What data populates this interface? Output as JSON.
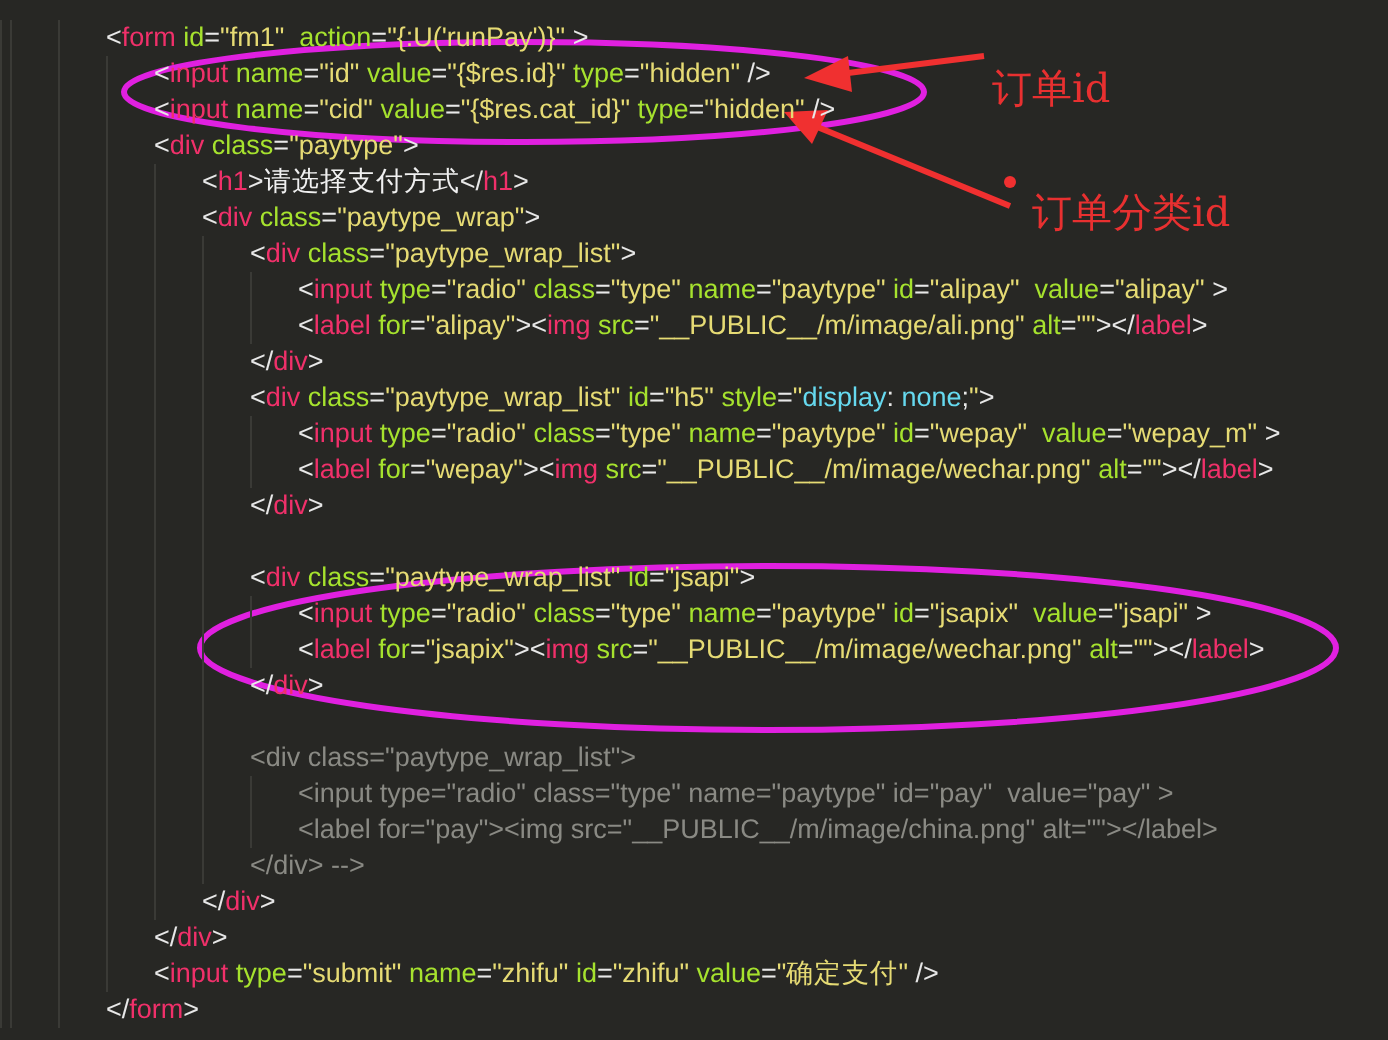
{
  "editor": {
    "lines": [
      {
        "tokens": [
          {
            "kind": "punct",
            "text": "<"
          },
          {
            "kind": "tag",
            "text": "form"
          },
          {
            "kind": "attr",
            "text": " id"
          },
          {
            "kind": "punct",
            "text": "="
          },
          {
            "kind": "string",
            "text": "\"fm1\""
          },
          {
            "kind": "attr",
            "text": "  action"
          },
          {
            "kind": "punct",
            "text": "="
          },
          {
            "kind": "string",
            "text": "\"{:U('runPay')}\""
          },
          {
            "kind": "punct",
            "text": " >"
          }
        ],
        "children": [
          {
            "tokens": [
              {
                "kind": "punct",
                "text": "<"
              },
              {
                "kind": "tag",
                "text": "input"
              },
              {
                "kind": "attr",
                "text": " name"
              },
              {
                "kind": "punct",
                "text": "="
              },
              {
                "kind": "string",
                "text": "\"id\""
              },
              {
                "kind": "attr",
                "text": " value"
              },
              {
                "kind": "punct",
                "text": "="
              },
              {
                "kind": "string",
                "text": "\"{$res.id}\""
              },
              {
                "kind": "attr",
                "text": " type"
              },
              {
                "kind": "punct",
                "text": "="
              },
              {
                "kind": "string",
                "text": "\"hidden\""
              },
              {
                "kind": "punct",
                "text": " />"
              }
            ]
          },
          {
            "tokens": [
              {
                "kind": "punct",
                "text": "<"
              },
              {
                "kind": "tag",
                "text": "input"
              },
              {
                "kind": "attr",
                "text": " name"
              },
              {
                "kind": "punct",
                "text": "="
              },
              {
                "kind": "string",
                "text": "\"cid\""
              },
              {
                "kind": "attr",
                "text": " value"
              },
              {
                "kind": "punct",
                "text": "="
              },
              {
                "kind": "string",
                "text": "\"{$res.cat_id}\""
              },
              {
                "kind": "attr",
                "text": " type"
              },
              {
                "kind": "punct",
                "text": "="
              },
              {
                "kind": "string",
                "text": "\"hidden\""
              },
              {
                "kind": "punct",
                "text": " />"
              }
            ]
          },
          {
            "tokens": [
              {
                "kind": "punct",
                "text": "<"
              },
              {
                "kind": "tag",
                "text": "div"
              },
              {
                "kind": "attr",
                "text": " class"
              },
              {
                "kind": "punct",
                "text": "="
              },
              {
                "kind": "string",
                "text": "\"paytype\""
              },
              {
                "kind": "punct",
                "text": ">"
              }
            ],
            "children": [
              {
                "tokens": [
                  {
                    "kind": "punct",
                    "text": "<"
                  },
                  {
                    "kind": "tag",
                    "text": "h1"
                  },
                  {
                    "kind": "punct",
                    "text": ">"
                  },
                  {
                    "kind": "text",
                    "text": "请选择支付方式"
                  },
                  {
                    "kind": "punct",
                    "text": "</"
                  },
                  {
                    "kind": "tag",
                    "text": "h1"
                  },
                  {
                    "kind": "punct",
                    "text": ">"
                  }
                ]
              },
              {
                "tokens": [
                  {
                    "kind": "punct",
                    "text": "<"
                  },
                  {
                    "kind": "tag",
                    "text": "div"
                  },
                  {
                    "kind": "attr",
                    "text": " class"
                  },
                  {
                    "kind": "punct",
                    "text": "="
                  },
                  {
                    "kind": "string",
                    "text": "\"paytype_wrap\""
                  },
                  {
                    "kind": "punct",
                    "text": ">"
                  }
                ],
                "children": [
                  {
                    "tokens": [
                      {
                        "kind": "punct",
                        "text": "<"
                      },
                      {
                        "kind": "tag",
                        "text": "div"
                      },
                      {
                        "kind": "attr",
                        "text": " class"
                      },
                      {
                        "kind": "punct",
                        "text": "="
                      },
                      {
                        "kind": "string",
                        "text": "\"paytype_wrap_list\""
                      },
                      {
                        "kind": "punct",
                        "text": ">"
                      }
                    ],
                    "children": [
                      {
                        "tokens": [
                          {
                            "kind": "punct",
                            "text": "<"
                          },
                          {
                            "kind": "tag",
                            "text": "input"
                          },
                          {
                            "kind": "attr",
                            "text": " type"
                          },
                          {
                            "kind": "punct",
                            "text": "="
                          },
                          {
                            "kind": "string",
                            "text": "\"radio\""
                          },
                          {
                            "kind": "attr",
                            "text": " class"
                          },
                          {
                            "kind": "punct",
                            "text": "="
                          },
                          {
                            "kind": "string",
                            "text": "\"type\""
                          },
                          {
                            "kind": "attr",
                            "text": " name"
                          },
                          {
                            "kind": "punct",
                            "text": "="
                          },
                          {
                            "kind": "string",
                            "text": "\"paytype\""
                          },
                          {
                            "kind": "attr",
                            "text": " id"
                          },
                          {
                            "kind": "punct",
                            "text": "="
                          },
                          {
                            "kind": "string",
                            "text": "\"alipay\""
                          },
                          {
                            "kind": "attr",
                            "text": "  value"
                          },
                          {
                            "kind": "punct",
                            "text": "="
                          },
                          {
                            "kind": "string",
                            "text": "\"alipay\""
                          },
                          {
                            "kind": "punct",
                            "text": " >"
                          }
                        ]
                      },
                      {
                        "tokens": [
                          {
                            "kind": "punct",
                            "text": "<"
                          },
                          {
                            "kind": "tag",
                            "text": "label"
                          },
                          {
                            "kind": "attr",
                            "text": " for"
                          },
                          {
                            "kind": "punct",
                            "text": "="
                          },
                          {
                            "kind": "string",
                            "text": "\"alipay\""
                          },
                          {
                            "kind": "punct",
                            "text": "><"
                          },
                          {
                            "kind": "tag",
                            "text": "img"
                          },
                          {
                            "kind": "attr",
                            "text": " src"
                          },
                          {
                            "kind": "punct",
                            "text": "="
                          },
                          {
                            "kind": "string",
                            "text": "\"__PUBLIC__/m/image/ali.png\""
                          },
                          {
                            "kind": "attr",
                            "text": " alt"
                          },
                          {
                            "kind": "punct",
                            "text": "="
                          },
                          {
                            "kind": "string",
                            "text": "\"\""
                          },
                          {
                            "kind": "punct",
                            "text": "></"
                          },
                          {
                            "kind": "tag",
                            "text": "label"
                          },
                          {
                            "kind": "punct",
                            "text": ">"
                          }
                        ]
                      }
                    ]
                  },
                  {
                    "tokens": [
                      {
                        "kind": "punct",
                        "text": "</"
                      },
                      {
                        "kind": "tag",
                        "text": "div"
                      },
                      {
                        "kind": "punct",
                        "text": ">"
                      }
                    ]
                  },
                  {
                    "tokens": [
                      {
                        "kind": "punct",
                        "text": "<"
                      },
                      {
                        "kind": "tag",
                        "text": "div"
                      },
                      {
                        "kind": "attr",
                        "text": " class"
                      },
                      {
                        "kind": "punct",
                        "text": "="
                      },
                      {
                        "kind": "string",
                        "text": "\"paytype_wrap_list\""
                      },
                      {
                        "kind": "attr",
                        "text": " id"
                      },
                      {
                        "kind": "punct",
                        "text": "="
                      },
                      {
                        "kind": "string",
                        "text": "\"h5\""
                      },
                      {
                        "kind": "attr",
                        "text": " style"
                      },
                      {
                        "kind": "punct",
                        "text": "="
                      },
                      {
                        "kind": "string",
                        "text": "\""
                      },
                      {
                        "kind": "css",
                        "text": "display"
                      },
                      {
                        "kind": "punct",
                        "text": ": "
                      },
                      {
                        "kind": "css",
                        "text": "none"
                      },
                      {
                        "kind": "punct",
                        "text": ";"
                      },
                      {
                        "kind": "string",
                        "text": "\""
                      },
                      {
                        "kind": "punct",
                        "text": ">"
                      }
                    ],
                    "children": [
                      {
                        "tokens": [
                          {
                            "kind": "punct",
                            "text": "<"
                          },
                          {
                            "kind": "tag",
                            "text": "input"
                          },
                          {
                            "kind": "attr",
                            "text": " type"
                          },
                          {
                            "kind": "punct",
                            "text": "="
                          },
                          {
                            "kind": "string",
                            "text": "\"radio\""
                          },
                          {
                            "kind": "attr",
                            "text": " class"
                          },
                          {
                            "kind": "punct",
                            "text": "="
                          },
                          {
                            "kind": "string",
                            "text": "\"type\""
                          },
                          {
                            "kind": "attr",
                            "text": " name"
                          },
                          {
                            "kind": "punct",
                            "text": "="
                          },
                          {
                            "kind": "string",
                            "text": "\"paytype\""
                          },
                          {
                            "kind": "attr",
                            "text": " id"
                          },
                          {
                            "kind": "punct",
                            "text": "="
                          },
                          {
                            "kind": "string",
                            "text": "\"wepay\""
                          },
                          {
                            "kind": "attr",
                            "text": "  value"
                          },
                          {
                            "kind": "punct",
                            "text": "="
                          },
                          {
                            "kind": "string",
                            "text": "\"wepay_m\""
                          },
                          {
                            "kind": "punct",
                            "text": " >"
                          }
                        ]
                      },
                      {
                        "tokens": [
                          {
                            "kind": "punct",
                            "text": "<"
                          },
                          {
                            "kind": "tag",
                            "text": "label"
                          },
                          {
                            "kind": "attr",
                            "text": " for"
                          },
                          {
                            "kind": "punct",
                            "text": "="
                          },
                          {
                            "kind": "string",
                            "text": "\"wepay\""
                          },
                          {
                            "kind": "punct",
                            "text": "><"
                          },
                          {
                            "kind": "tag",
                            "text": "img"
                          },
                          {
                            "kind": "attr",
                            "text": " src"
                          },
                          {
                            "kind": "punct",
                            "text": "="
                          },
                          {
                            "kind": "string",
                            "text": "\"__PUBLIC__/m/image/wechar.png\""
                          },
                          {
                            "kind": "attr",
                            "text": " alt"
                          },
                          {
                            "kind": "punct",
                            "text": "="
                          },
                          {
                            "kind": "string",
                            "text": "\"\""
                          },
                          {
                            "kind": "punct",
                            "text": "></"
                          },
                          {
                            "kind": "tag",
                            "text": "label"
                          },
                          {
                            "kind": "punct",
                            "text": ">"
                          }
                        ]
                      }
                    ]
                  },
                  {
                    "tokens": [
                      {
                        "kind": "punct",
                        "text": "</"
                      },
                      {
                        "kind": "tag",
                        "text": "div"
                      },
                      {
                        "kind": "punct",
                        "text": ">"
                      }
                    ]
                  },
                  {
                    "kind": "blank"
                  },
                  {
                    "tokens": [
                      {
                        "kind": "punct",
                        "text": "<"
                      },
                      {
                        "kind": "tag",
                        "text": "div"
                      },
                      {
                        "kind": "attr",
                        "text": " class"
                      },
                      {
                        "kind": "punct",
                        "text": "="
                      },
                      {
                        "kind": "string",
                        "text": "\"paytype_wrap_list\""
                      },
                      {
                        "kind": "attr",
                        "text": " id"
                      },
                      {
                        "kind": "punct",
                        "text": "="
                      },
                      {
                        "kind": "string",
                        "text": "\"jsapi\""
                      },
                      {
                        "kind": "punct",
                        "text": ">"
                      }
                    ],
                    "children": [
                      {
                        "tokens": [
                          {
                            "kind": "punct",
                            "text": "<"
                          },
                          {
                            "kind": "tag",
                            "text": "input"
                          },
                          {
                            "kind": "attr",
                            "text": " type"
                          },
                          {
                            "kind": "punct",
                            "text": "="
                          },
                          {
                            "kind": "string",
                            "text": "\"radio\""
                          },
                          {
                            "kind": "attr",
                            "text": " class"
                          },
                          {
                            "kind": "punct",
                            "text": "="
                          },
                          {
                            "kind": "string",
                            "text": "\"type\""
                          },
                          {
                            "kind": "attr",
                            "text": " name"
                          },
                          {
                            "kind": "punct",
                            "text": "="
                          },
                          {
                            "kind": "string",
                            "text": "\"paytype\""
                          },
                          {
                            "kind": "attr",
                            "text": " id"
                          },
                          {
                            "kind": "punct",
                            "text": "="
                          },
                          {
                            "kind": "string",
                            "text": "\"jsapix\""
                          },
                          {
                            "kind": "attr",
                            "text": "  value"
                          },
                          {
                            "kind": "punct",
                            "text": "="
                          },
                          {
                            "kind": "string",
                            "text": "\"jsapi\""
                          },
                          {
                            "kind": "punct",
                            "text": " >"
                          }
                        ]
                      },
                      {
                        "tokens": [
                          {
                            "kind": "punct",
                            "text": "<"
                          },
                          {
                            "kind": "tag",
                            "text": "label"
                          },
                          {
                            "kind": "attr",
                            "text": " for"
                          },
                          {
                            "kind": "punct",
                            "text": "="
                          },
                          {
                            "kind": "string",
                            "text": "\"jsapix\""
                          },
                          {
                            "kind": "punct",
                            "text": "><"
                          },
                          {
                            "kind": "tag",
                            "text": "img"
                          },
                          {
                            "kind": "attr",
                            "text": " src"
                          },
                          {
                            "kind": "punct",
                            "text": "="
                          },
                          {
                            "kind": "string",
                            "text": "\"__PUBLIC__/m/image/wechar.png\""
                          },
                          {
                            "kind": "attr",
                            "text": " alt"
                          },
                          {
                            "kind": "punct",
                            "text": "="
                          },
                          {
                            "kind": "string",
                            "text": "\"\""
                          },
                          {
                            "kind": "punct",
                            "text": "></"
                          },
                          {
                            "kind": "tag",
                            "text": "label"
                          },
                          {
                            "kind": "punct",
                            "text": ">"
                          }
                        ]
                      }
                    ]
                  },
                  {
                    "tokens": [
                      {
                        "kind": "punct",
                        "text": "</"
                      },
                      {
                        "kind": "tag",
                        "text": "div"
                      },
                      {
                        "kind": "punct",
                        "text": ">"
                      }
                    ]
                  },
                  {
                    "kind": "blank"
                  },
                  {
                    "tokens": [
                      {
                        "kind": "comment",
                        "text": "<div class=\"paytype_wrap_list\">"
                      }
                    ],
                    "children": [
                      {
                        "tokens": [
                          {
                            "kind": "comment",
                            "text": "<input type=\"radio\" class=\"type\" name=\"paytype\" id=\"pay\"  value=\"pay\" >"
                          }
                        ]
                      },
                      {
                        "tokens": [
                          {
                            "kind": "comment",
                            "text": "<label for=\"pay\"><img src=\"__PUBLIC__/m/image/china.png\" alt=\"\"></label>"
                          }
                        ]
                      }
                    ]
                  },
                  {
                    "tokens": [
                      {
                        "kind": "comment",
                        "text": "</div> -->"
                      }
                    ]
                  }
                ]
              },
              {
                "tokens": [
                  {
                    "kind": "punct",
                    "text": "</"
                  },
                  {
                    "kind": "tag",
                    "text": "div"
                  },
                  {
                    "kind": "punct",
                    "text": ">"
                  }
                ]
              }
            ]
          },
          {
            "tokens": [
              {
                "kind": "punct",
                "text": "</"
              },
              {
                "kind": "tag",
                "text": "div"
              },
              {
                "kind": "punct",
                "text": ">"
              }
            ]
          },
          {
            "tokens": [
              {
                "kind": "punct",
                "text": "<"
              },
              {
                "kind": "tag",
                "text": "input"
              },
              {
                "kind": "attr",
                "text": " type"
              },
              {
                "kind": "punct",
                "text": "="
              },
              {
                "kind": "string",
                "text": "\"submit\""
              },
              {
                "kind": "attr",
                "text": " name"
              },
              {
                "kind": "punct",
                "text": "="
              },
              {
                "kind": "string",
                "text": "\"zhifu\""
              },
              {
                "kind": "attr",
                "text": " id"
              },
              {
                "kind": "punct",
                "text": "="
              },
              {
                "kind": "string",
                "text": "\"zhifu\""
              },
              {
                "kind": "attr",
                "text": " value"
              },
              {
                "kind": "punct",
                "text": "="
              },
              {
                "kind": "string",
                "text": "\"确定支付\""
              },
              {
                "kind": "punct",
                "text": " />"
              }
            ]
          }
        ]
      },
      {
        "tokens": [
          {
            "kind": "punct",
            "text": "</"
          },
          {
            "kind": "tag",
            "text": "form"
          },
          {
            "kind": "punct",
            "text": ">"
          }
        ]
      }
    ]
  },
  "annotations": [
    {
      "text": "订单id"
    },
    {
      "text": "订单分类id"
    }
  ]
}
